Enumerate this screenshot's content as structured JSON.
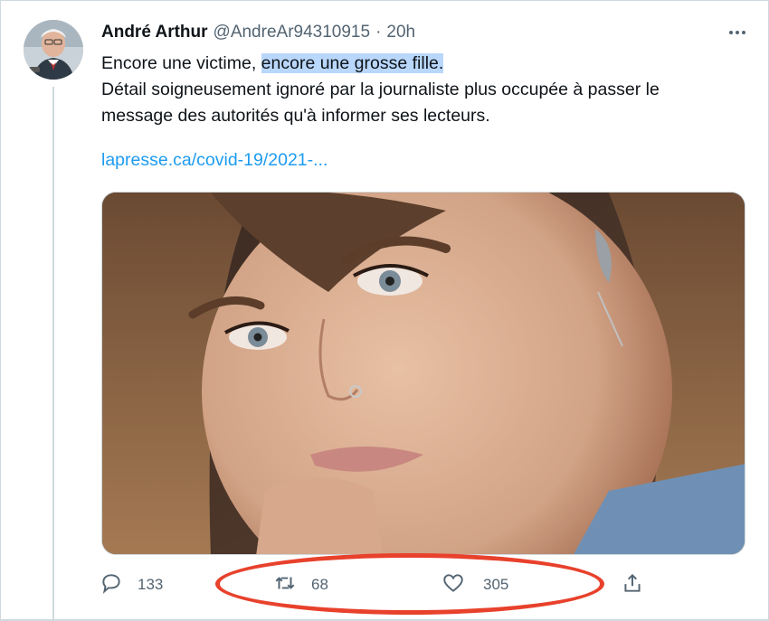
{
  "tweet": {
    "author_name": "André Arthur",
    "handle": "@AndreAr94310915",
    "separator": "·",
    "time": "20h",
    "text_line1_plain": "Encore une victime, ",
    "text_line1_highlight": "encore une grosse fille.",
    "text_paragraph": "Détail soigneusement ignoré par la journaliste plus occupée à passer le message des autorités qu'à informer ses lecteurs.",
    "link": "lapresse.ca/covid-19/2021-..."
  },
  "actions": {
    "reply_count": "133",
    "retweet_count": "68",
    "like_count": "305"
  },
  "icons": {
    "more": "more-horizontal-icon",
    "reply": "reply-icon",
    "retweet": "retweet-icon",
    "like": "heart-icon",
    "share": "share-icon"
  },
  "colors": {
    "link": "#1d9bf0",
    "highlight": "#b9d7fb",
    "annotation_ring": "#e8412c",
    "secondary_text": "#536471"
  }
}
